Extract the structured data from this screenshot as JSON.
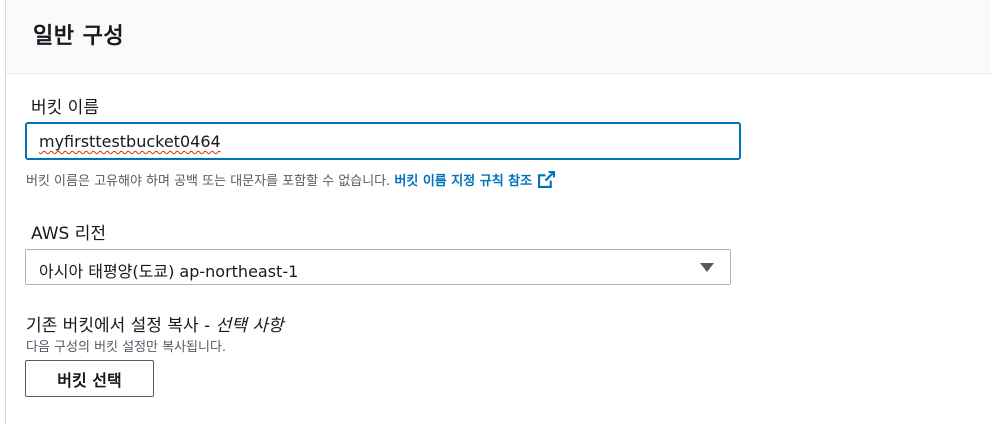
{
  "panel": {
    "title": "일반 구성"
  },
  "bucket_name": {
    "label": "버킷 이름",
    "value": "myfirsttestbucket0464",
    "hint": "버킷 이름은 고유해야 하며 공백 또는 대문자를 포함할 수 없습니다. ",
    "rules_link": "버킷 이름 지정 규칙 참조",
    "rules_link_icon": "external-link-icon"
  },
  "region": {
    "label": "AWS 리전",
    "selected": "아시아 태평양(도쿄) ap-northeast-1",
    "icon": "caret-down-icon"
  },
  "copy_settings": {
    "label": "기존 버킷에서 설정 복사 - ",
    "optional": "선택 사항",
    "description": "다음 구성의 버킷 설정만 복사됩니다.",
    "button_label": "버킷 선택"
  },
  "colors": {
    "accent": "#0073bb",
    "text": "#16191f",
    "muted": "#545b64",
    "header_bg": "#fafafa"
  }
}
